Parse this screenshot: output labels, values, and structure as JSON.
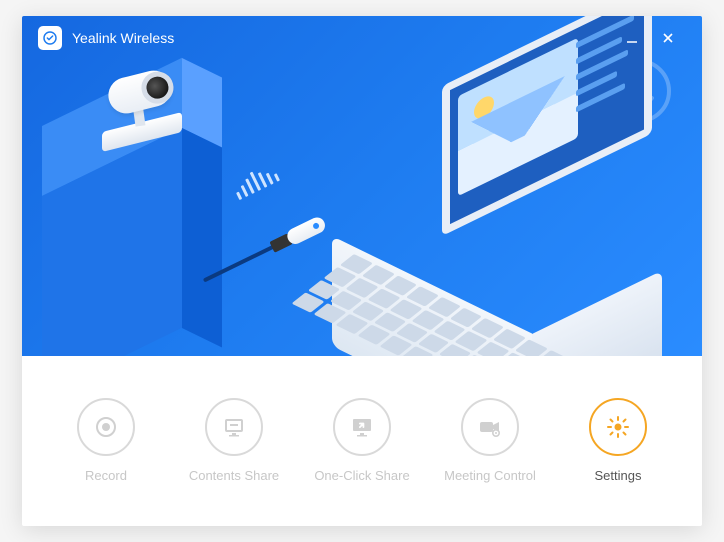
{
  "app": {
    "title": "Yealink Wireless"
  },
  "toolbar": {
    "items": [
      {
        "label": "Record"
      },
      {
        "label": "Contents Share"
      },
      {
        "label": "One-Click Share"
      },
      {
        "label": "Meeting Control"
      },
      {
        "label": "Settings"
      }
    ]
  },
  "colors": {
    "accent": "#f5a623",
    "brand": "#1e7cf0"
  }
}
